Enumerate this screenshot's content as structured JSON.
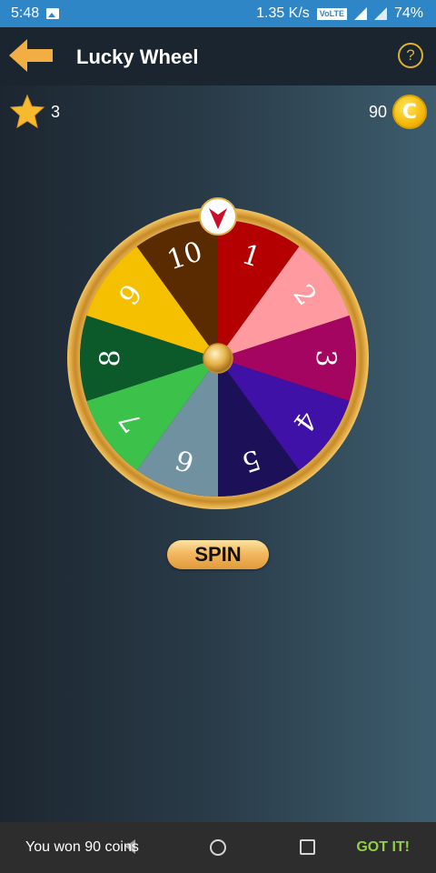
{
  "status_bar": {
    "time": "5:48",
    "network_speed": "1.35 K/s",
    "volte": "VoLTE",
    "battery": "74%"
  },
  "header": {
    "title": "Lucky Wheel",
    "help_label": "?"
  },
  "counters": {
    "stars": "3",
    "coins": "90",
    "coin_symbol": "C"
  },
  "wheel": {
    "segments": [
      {
        "label": "1",
        "color": "#b40000"
      },
      {
        "label": "2",
        "color": "#ff9aa0"
      },
      {
        "label": "3",
        "color": "#a30560"
      },
      {
        "label": "4",
        "color": "#3f11a6"
      },
      {
        "label": "5",
        "color": "#1c1158"
      },
      {
        "label": "6",
        "color": "#6f91a0"
      },
      {
        "label": "7",
        "color": "#3cc14a"
      },
      {
        "label": "8",
        "color": "#0c5a2a"
      },
      {
        "label": "9",
        "color": "#f5c000"
      },
      {
        "label": "10",
        "color": "#5a2b00"
      }
    ],
    "rim_color": "#e8b64a",
    "pointer_color": "#c8102e"
  },
  "spin_button": {
    "label": "SPIN"
  },
  "snackbar": {
    "message": "You won 90 coins",
    "action": "GOT IT!"
  }
}
